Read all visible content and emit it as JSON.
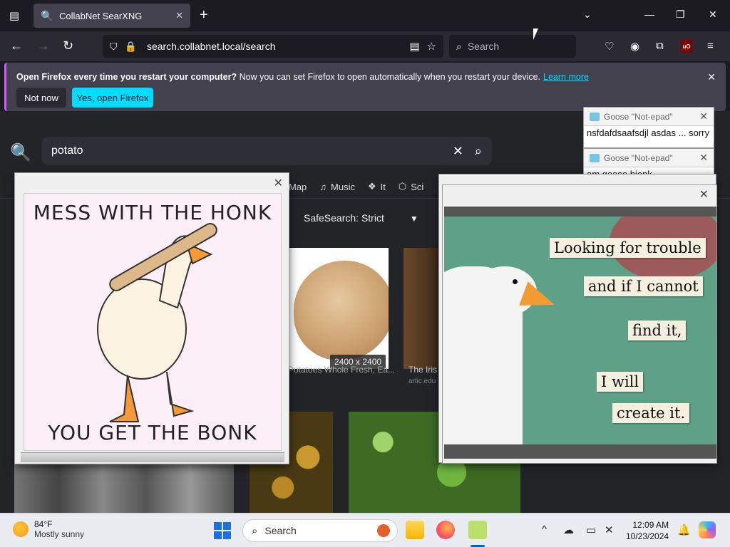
{
  "browser": {
    "tab_title": "CollabNet SearXNG",
    "url": "search.collabnet.local/search",
    "search_placeholder": "Search"
  },
  "notification": {
    "bold": "Open Firefox every time you restart your computer?",
    "text": " Now you can set Firefox to open automatically when you restart your device.",
    "learn_more": "Learn more",
    "not_now": "Not now",
    "yes_open": "Yes, open Firefox"
  },
  "searx": {
    "query": "potato",
    "categories": [
      "Map",
      "Music",
      "It",
      "Sci"
    ],
    "safesearch": "SafeSearch: Strict",
    "result_dims": "2400 x 2400",
    "result1_caption": "Potatoes Whole Fresh, Ea...",
    "result2_caption": "The Iris",
    "result2_source": "artic.edu"
  },
  "goose_poster": {
    "top": "MESS WITH THE HONK",
    "bottom": "YOU GET THE BONK"
  },
  "goose_notes": {
    "n1": "Looking for trouble",
    "n2": "and if I cannot",
    "n3": "find it,",
    "n4": "I will",
    "n5": "create it."
  },
  "notepads": [
    {
      "title": "Goose \"Not-epad\"",
      "text": "nsfdafdsaafsdjl asdas ... sorry"
    },
    {
      "title": "Goose \"Not-epad\"",
      "text": "am goose hjonk"
    }
  ],
  "taskbar": {
    "temp": "84°F",
    "weather": "Mostly sunny",
    "search": "Search",
    "time": "12:09 AM",
    "date": "10/23/2024"
  }
}
